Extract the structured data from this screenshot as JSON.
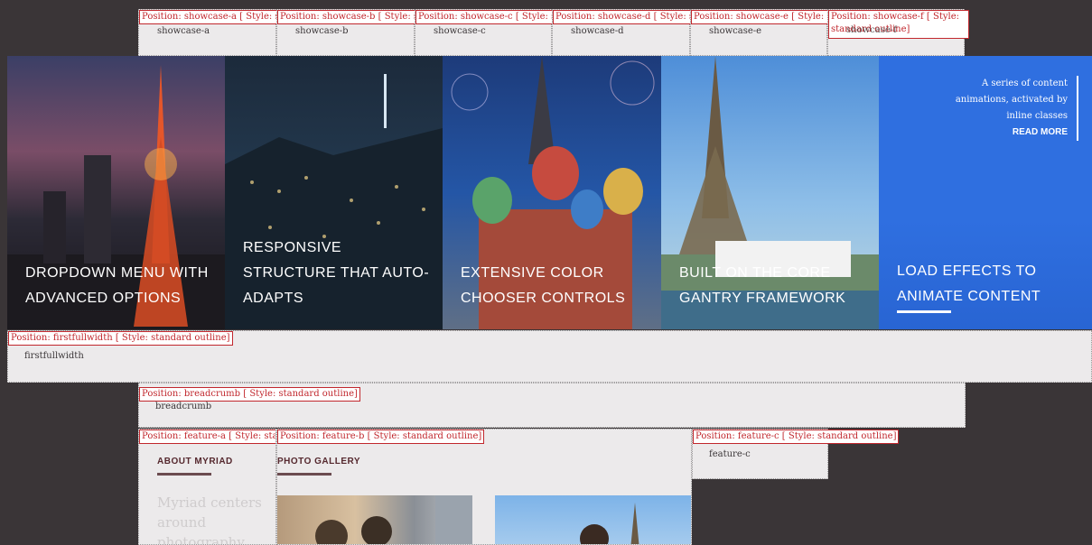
{
  "showcase": [
    {
      "tag": "Position: showcase-a [ Style: s",
      "name": "showcase-a"
    },
    {
      "tag": "Position: showcase-b [ Style: s",
      "name": "showcase-b"
    },
    {
      "tag": "Position: showcase-c [ Style: s",
      "name": "showcase-c"
    },
    {
      "tag": "Position: showcase-d [ Style: s",
      "name": "showcase-d"
    },
    {
      "tag": "Position: showcase-e [ Style: s",
      "name": "showcase-e"
    },
    {
      "tag": "Position: showcase-f [ Style:",
      "tag2": "standard outline]",
      "name": "showcase-f"
    }
  ],
  "tiles": [
    {
      "title": "DROPDOWN MENU WITH ADVANCED OPTIONS"
    },
    {
      "title": "RESPONSIVE STRUCTURE THAT AUTO-ADAPTS"
    },
    {
      "title": "EXTENSIVE COLOR CHOOSER CONTROLS"
    },
    {
      "title": "BUILT ON THE CORE GANTRY FRAMEWORK"
    },
    {
      "title": "LOAD EFFECTS TO ANIMATE CONTENT"
    }
  ],
  "promo": {
    "text": "A series of content animations, activated by inline classes",
    "read_more": "READ MORE"
  },
  "firstfullwidth": {
    "tag": "Position: firstfullwidth [ Style: standard outline]",
    "name": "firstfullwidth"
  },
  "breadcrumb": {
    "tag": "Position: breadcrumb [ Style: standard outline]",
    "name": "breadcrumb"
  },
  "feature_a": {
    "tag": "Position: feature-a [ Style: star",
    "heading": "ABOUT MYRIAD",
    "body": "Myriad centers around photography"
  },
  "feature_b": {
    "tag": "Position: feature-b [ Style: standard outline]",
    "heading": "PHOTO GALLERY"
  },
  "feature_c": {
    "tag": "Position: feature-c [ Style: standard outline]",
    "name": "feature-c"
  },
  "colors": {
    "dark": "#3a3537",
    "light": "#eceaeb",
    "tag_red": "#c1272d",
    "heading": "#55282e",
    "blue_overlay": "#2f6fe0"
  }
}
